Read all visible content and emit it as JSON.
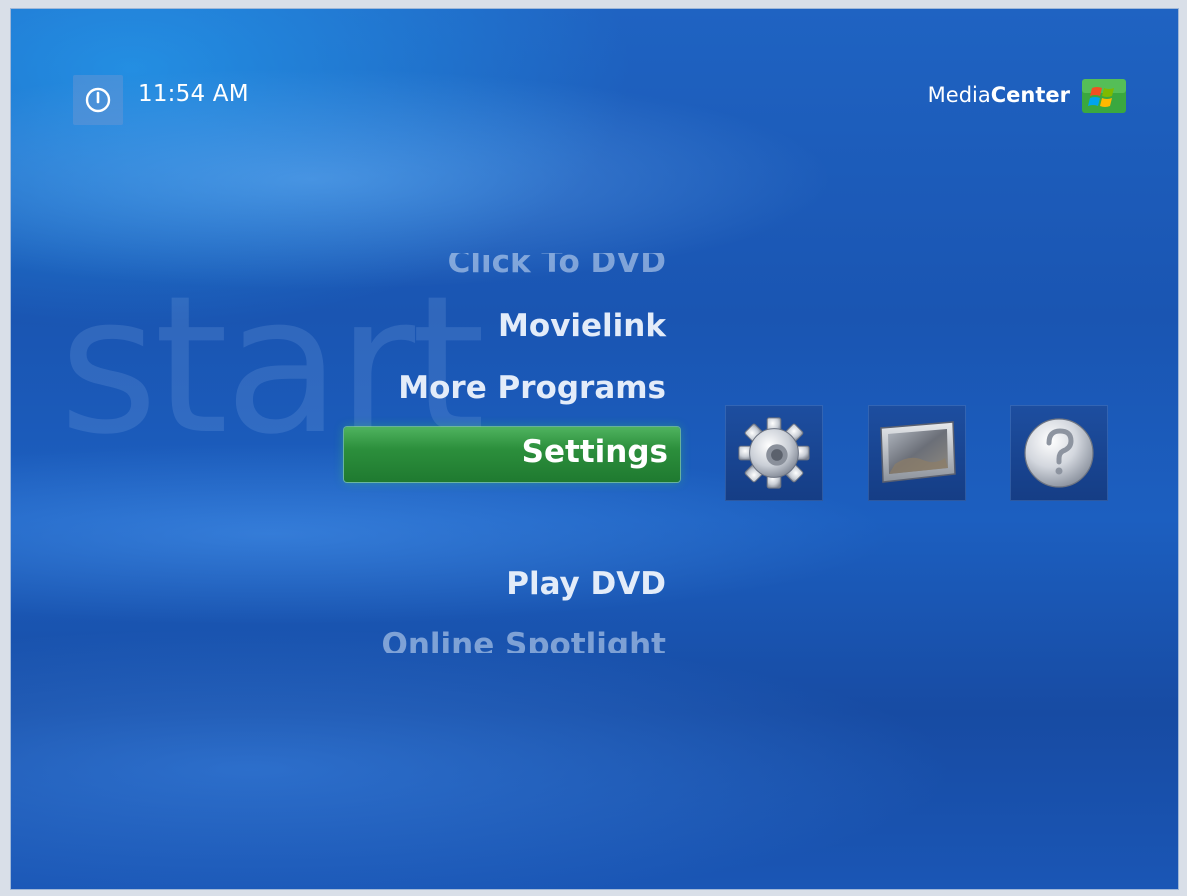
{
  "header": {
    "clock": "11:54 AM",
    "brand_light": "Media",
    "brand_bold": "Center"
  },
  "background_watermark": "start",
  "menu": {
    "items": [
      {
        "label": "Click To DVD",
        "state": "partially-visible"
      },
      {
        "label": "Movielink",
        "state": "normal"
      },
      {
        "label": "More Programs",
        "state": "normal"
      },
      {
        "label": "Settings",
        "state": "selected"
      },
      {
        "label": "Play DVD",
        "state": "normal"
      },
      {
        "label": "Online Spotlight",
        "state": "partially-visible"
      }
    ]
  },
  "tiles": [
    {
      "icon": "settings-gear-icon"
    },
    {
      "icon": "monitor-display-icon"
    },
    {
      "icon": "help-question-icon"
    }
  ],
  "colors": {
    "background": "#1a55b2",
    "selection": "#2c8f3c",
    "text": "#ffffff"
  }
}
